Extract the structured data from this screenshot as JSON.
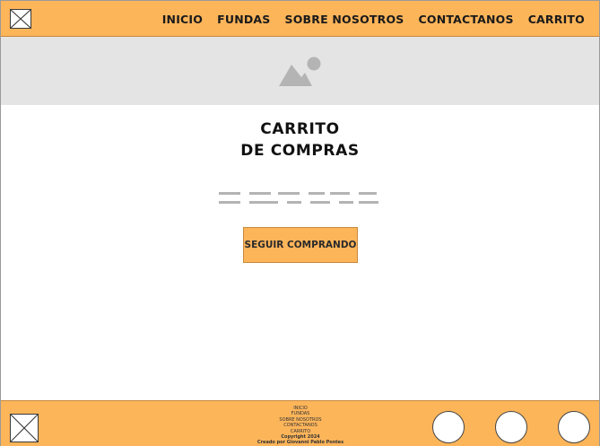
{
  "header": {
    "logo_icon": "image-placeholder-icon",
    "nav": [
      "INICIO",
      "FUNDAS",
      "SOBRE NOSOTROS",
      "CONTACTANOS",
      "CARRITO"
    ]
  },
  "banner": {
    "icon": "image-placeholder-icon"
  },
  "main": {
    "title_line1": "CARRITO",
    "title_line2": "DE COMPRAS",
    "text_placeholder": "text-lines-placeholder",
    "button_label": "SEGUIR COMPRANDO"
  },
  "footer": {
    "logo_icon": "image-placeholder-icon",
    "links": [
      "INICIO",
      "FUNDAS",
      "SOBRE NOSOTROS",
      "CONTACTANOS",
      "CARRITO"
    ],
    "copyright": "Copyright 2024",
    "credit": "Creado por Giovanni Pablo Pontes",
    "social_icons": [
      "social-circle-icon",
      "social-circle-icon",
      "social-circle-icon"
    ]
  },
  "colors": {
    "accent": "#fdb55a",
    "banner": "#e4e4e4",
    "placeholder": "#b4b4b4"
  }
}
